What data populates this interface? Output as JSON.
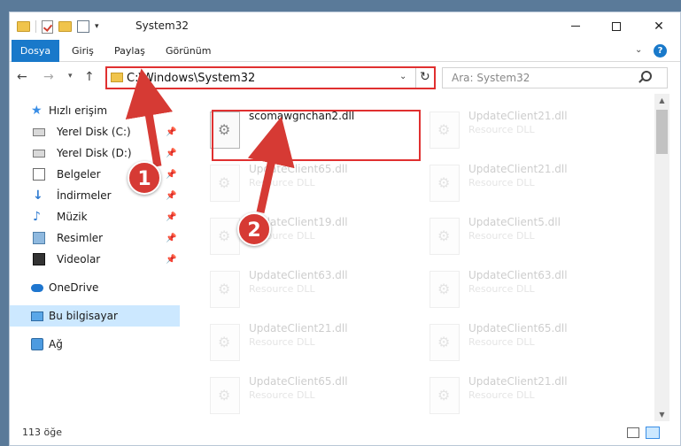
{
  "window": {
    "title": "System32",
    "minimize_glyph": "",
    "close_glyph": "✕"
  },
  "ribbon": {
    "tabs": [
      "Dosya",
      "Giriş",
      "Paylaş",
      "Görünüm"
    ],
    "help": "?"
  },
  "navbar": {
    "address": "C:\\Windows\\System32",
    "search_placeholder": "Ara: System32"
  },
  "sidebar": {
    "quick_access": "Hızlı erişim",
    "items": [
      {
        "label": "Yerel Disk (C:)",
        "icon": "drive-icon",
        "pinned": true
      },
      {
        "label": "Yerel Disk (D:)",
        "icon": "drive-icon",
        "pinned": true
      },
      {
        "label": "Belgeler",
        "icon": "documents-icon",
        "pinned": true
      },
      {
        "label": "İndirmeler",
        "icon": "downloads-icon",
        "pinned": true
      },
      {
        "label": "Müzik",
        "icon": "music-icon",
        "pinned": true
      },
      {
        "label": "Resimler",
        "icon": "pictures-icon",
        "pinned": true
      },
      {
        "label": "Videolar",
        "icon": "videos-icon",
        "pinned": true
      }
    ],
    "onedrive": "OneDrive",
    "this_pc": "Bu bilgisayar",
    "network": "Ağ"
  },
  "files": {
    "left": [
      {
        "name": "scomawgnchan2.dll",
        "type": ""
      },
      {
        "name": "UpdateClient65.dll",
        "type": "Resource DLL"
      },
      {
        "name": "UpdateClient19.dll",
        "type": "Resource DLL"
      },
      {
        "name": "UpdateClient63.dll",
        "type": "Resource DLL"
      },
      {
        "name": "UpdateClient21.dll",
        "type": "Resource DLL"
      },
      {
        "name": "UpdateClient65.dll",
        "type": "Resource DLL"
      }
    ],
    "right": [
      {
        "name": "UpdateClient21.dll",
        "type": "Resource DLL"
      },
      {
        "name": "UpdateClient21.dll",
        "type": "Resource DLL"
      },
      {
        "name": "UpdateClient5.dll",
        "type": "Resource DLL"
      },
      {
        "name": "UpdateClient63.dll",
        "type": "Resource DLL"
      },
      {
        "name": "UpdateClient65.dll",
        "type": "Resource DLL"
      },
      {
        "name": "UpdateClient21.dll",
        "type": "Resource DLL"
      }
    ]
  },
  "status": {
    "count": "113 öğe"
  },
  "callouts": [
    "1",
    "2"
  ],
  "colors": {
    "accent": "#1979ca",
    "highlight": "#e03030",
    "callout": "#d63a34"
  }
}
